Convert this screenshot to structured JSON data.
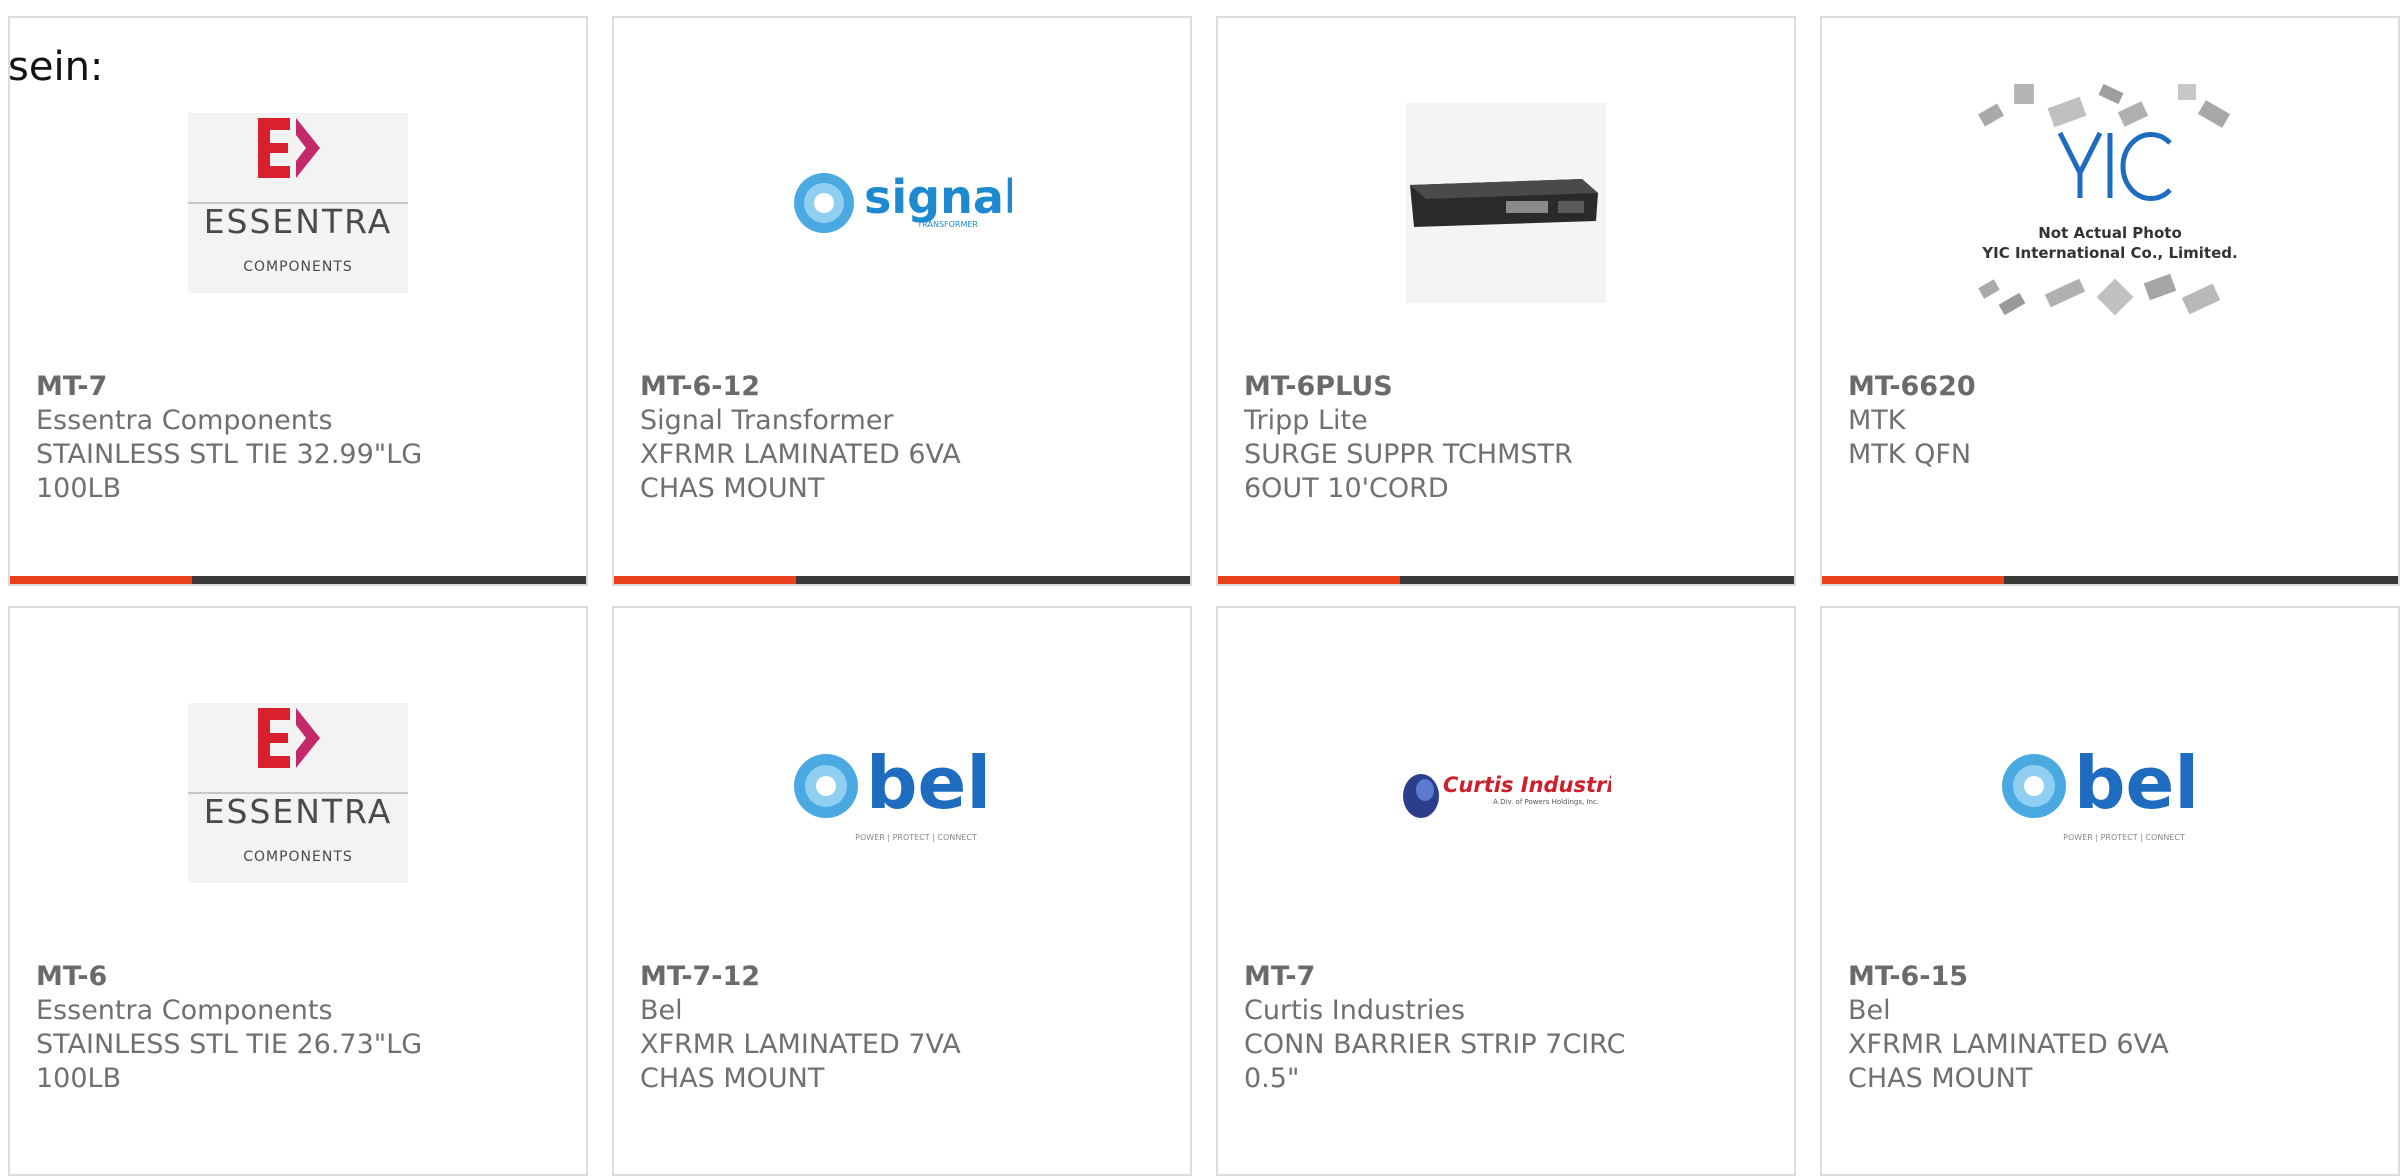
{
  "intro_text": "sein:",
  "colors": {
    "accent": "#e8411c",
    "bar_dark": "#3a3a3a",
    "text": "#707070",
    "border": "#dcdcdc"
  },
  "products": [
    {
      "part": "MT-7",
      "manufacturer": "Essentra Components",
      "description": "STAINLESS STL TIE 32.99\"LG 100LB",
      "logo": "essentra-logo",
      "logo_text": "ESSENTRA",
      "logo_sub": "COMPONENTS"
    },
    {
      "part": "MT-6-12",
      "manufacturer": "Signal Transformer",
      "description": "XFRMR LAMINATED 6VA CHAS MOUNT",
      "logo": "signal-logo",
      "logo_text": "signal",
      "logo_sub": "TRANSFORMER"
    },
    {
      "part": "MT-6PLUS",
      "manufacturer": "Tripp Lite",
      "description": "SURGE SUPPR TCHMSTR 6OUT 10'CORD",
      "logo": "surge-suppressor-photo"
    },
    {
      "part": "MT-6620",
      "manufacturer": "MTK",
      "description": "MTK QFN",
      "logo": "yic-placeholder-photo",
      "logo_text": "YIC",
      "logo_sub": "Not Actual Photo",
      "logo_sub2": "YIC International Co., Limited."
    },
    {
      "part": "MT-6",
      "manufacturer": "Essentra Components",
      "description": "STAINLESS STL TIE 26.73\"LG 100LB",
      "logo": "essentra-logo",
      "logo_text": "ESSENTRA",
      "logo_sub": "COMPONENTS"
    },
    {
      "part": "MT-7-12",
      "manufacturer": "Bel",
      "description": "XFRMR LAMINATED 7VA CHAS MOUNT",
      "logo": "bel-logo",
      "logo_text": "bel",
      "logo_sub": "POWER | PROTECT | CONNECT"
    },
    {
      "part": "MT-7",
      "manufacturer": "Curtis Industries",
      "description": "CONN BARRIER STRIP 7CIRC 0.5\"",
      "logo": "curtis-logo",
      "logo_text": "Curtis Industries",
      "logo_sub": "A Div. of Powers Holdings, Inc."
    },
    {
      "part": "MT-6-15",
      "manufacturer": "Bel",
      "description": "XFRMR LAMINATED 6VA CHAS MOUNT",
      "logo": "bel-logo",
      "logo_text": "bel",
      "logo_sub": "POWER | PROTECT | CONNECT"
    }
  ]
}
